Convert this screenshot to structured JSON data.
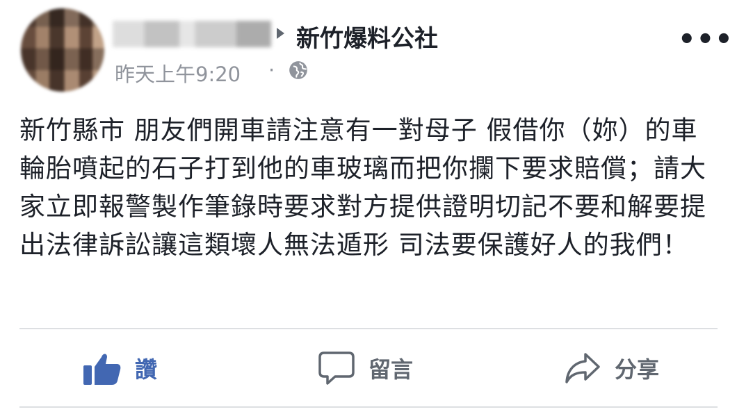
{
  "post": {
    "author_name_blurred": "",
    "group_name": "新竹爆料公社",
    "timestamp": "昨天上午9:20",
    "separator": "·",
    "privacy_icon": "globe-icon",
    "more_label": "•••",
    "body": "新竹縣市 朋友們開車請注意有一對母子 假借你（妳）的車輪胎噴起的石子打到他的車玻璃而把你攔下要求賠償；請大家立即報警製作筆錄時要求對方提供證明切記不要和解要提出法律訴訟讓這類壞人無法遁形 司法要保護好人的我們！"
  },
  "actions": {
    "like_label": "讚",
    "comment_label": "留言",
    "share_label": "分享"
  },
  "colors": {
    "accent": "#4267b2",
    "text": "#1d2129",
    "muted": "#90949c",
    "icon": "#606770"
  }
}
